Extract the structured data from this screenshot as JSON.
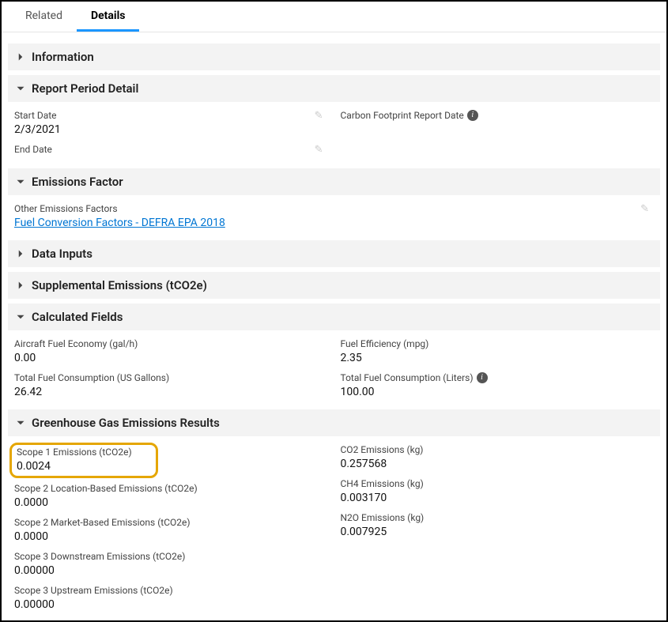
{
  "tabs": {
    "related": "Related",
    "details": "Details"
  },
  "sections": {
    "information": {
      "title": "Information"
    },
    "reportPeriod": {
      "title": "Report Period Detail",
      "startDateLabel": "Start Date",
      "startDateValue": "2/3/2021",
      "endDateLabel": "End Date",
      "endDateValue": "",
      "reportDateLabel": "Carbon Footprint Report Date"
    },
    "emissionsFactor": {
      "title": "Emissions Factor",
      "otherLabel": "Other Emissions Factors",
      "otherLink": "Fuel Conversion Factors - DEFRA EPA 2018"
    },
    "dataInputs": {
      "title": "Data Inputs"
    },
    "supplemental": {
      "title": "Supplemental Emissions (tCO2e)"
    },
    "calculated": {
      "title": "Calculated Fields",
      "aircraftLabel": "Aircraft Fuel Economy (gal/h)",
      "aircraftValue": "0.00",
      "totalFuelGalLabel": "Total Fuel Consumption (US Gallons)",
      "totalFuelGalValue": "26.42",
      "fuelEffLabel": "Fuel Efficiency (mpg)",
      "fuelEffValue": "2.35",
      "totalFuelLitersLabel": "Total Fuel Consumption (Liters)",
      "totalFuelLitersValue": "100.00"
    },
    "ghg": {
      "title": "Greenhouse Gas Emissions Results",
      "scope1Label": "Scope 1 Emissions (tCO2e)",
      "scope1Value": "0.0024",
      "scope2LocLabel": "Scope 2 Location-Based Emissions (tCO2e)",
      "scope2LocValue": "0.0000",
      "scope2MktLabel": "Scope 2 Market-Based Emissions (tCO2e)",
      "scope2MktValue": "0.0000",
      "scope3DownLabel": "Scope 3 Downstream Emissions (tCO2e)",
      "scope3DownValue": "0.00000",
      "scope3UpLabel": "Scope 3 Upstream Emissions (tCO2e)",
      "scope3UpValue": "0.00000",
      "co2Label": "CO2 Emissions (kg)",
      "co2Value": "0.257568",
      "ch4Label": "CH4 Emissions (kg)",
      "ch4Value": "0.003170",
      "n2oLabel": "N2O Emissions (kg)",
      "n2oValue": "0.007925"
    }
  }
}
